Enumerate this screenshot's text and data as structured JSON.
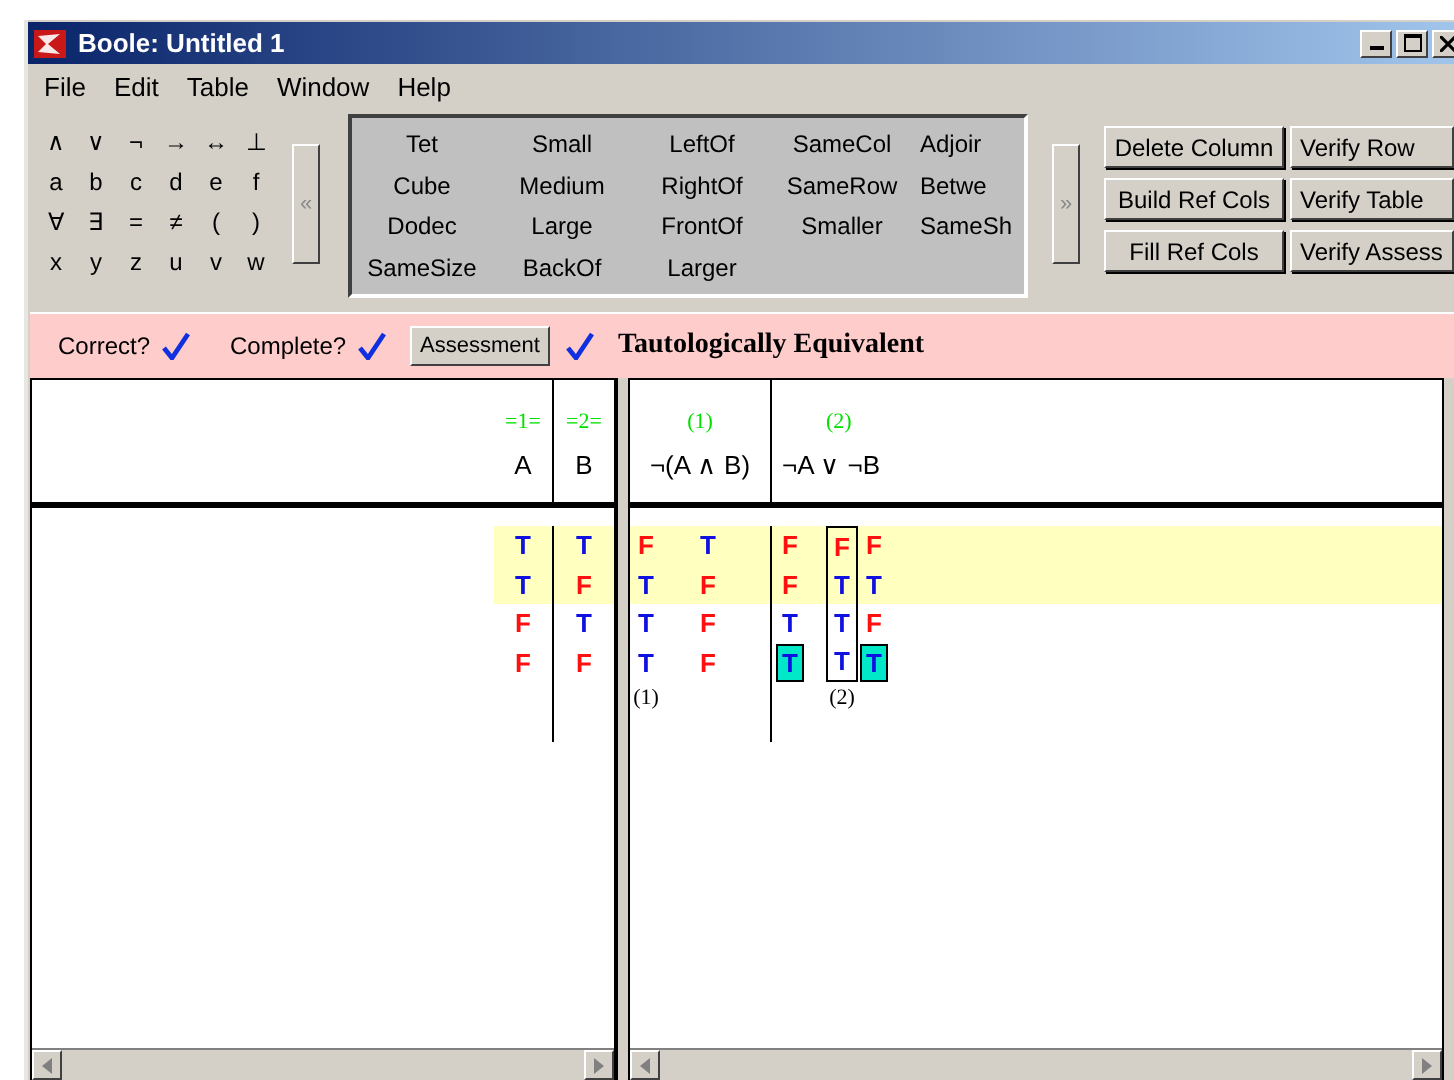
{
  "window": {
    "title": "Boole: Untitled 1"
  },
  "menu": [
    "File",
    "Edit",
    "Table",
    "Window",
    "Help"
  ],
  "symbols": [
    [
      "∧",
      "∨",
      "¬",
      "→",
      "↔",
      "⊥"
    ],
    [
      "a",
      "b",
      "c",
      "d",
      "e",
      "f"
    ],
    [
      "∀",
      "∃",
      "=",
      "≠",
      "(",
      ")"
    ],
    [
      "x",
      "y",
      "z",
      "u",
      "v",
      "w"
    ]
  ],
  "collapse_button": "«",
  "predicates": [
    [
      "Tet",
      "Small",
      "LeftOf",
      "SameCol",
      "Adjoir"
    ],
    [
      "Cube",
      "Medium",
      "RightOf",
      "SameRow",
      "Betwe"
    ],
    [
      "Dodec",
      "Large",
      "FrontOf",
      "Smaller",
      "SameSh"
    ],
    [
      "SameSize",
      "BackOf",
      "Larger"
    ]
  ],
  "expand_button": "»",
  "actions": [
    [
      "Delete Column",
      "Verify Row"
    ],
    [
      "Build Ref Cols",
      "Verify Table"
    ],
    [
      "Fill Ref Cols",
      "Verify Assess"
    ]
  ],
  "assessment": {
    "correct_label": "Correct?",
    "correct": true,
    "complete_label": "Complete?",
    "complete": true,
    "button": "Assessment",
    "assessed": true,
    "verdict": "Tautologically Equivalent"
  },
  "table": {
    "rows": [
      {
        "highlighted": true
      },
      {
        "highlighted": true
      },
      {
        "highlighted": false
      },
      {
        "highlighted": false
      }
    ],
    "ref_columns": [
      {
        "label": "=1=",
        "atom": "A",
        "cells": [
          {
            "value": "T",
            "truth": true
          },
          {
            "value": "T",
            "truth": true
          },
          {
            "value": "F",
            "truth": false
          },
          {
            "value": "F",
            "truth": false
          }
        ]
      },
      {
        "label": "=2=",
        "atom": "B",
        "cells": [
          {
            "value": "T",
            "truth": true
          },
          {
            "value": "F",
            "truth": false
          },
          {
            "value": "T",
            "truth": true
          },
          {
            "value": "F",
            "truth": false
          }
        ]
      }
    ],
    "formulas": [
      {
        "number": "(1)",
        "text": "¬(A ∧ B)",
        "columns": [
          {
            "main": true,
            "selected": false,
            "marker": "(1)",
            "cells": [
              {
                "value": "F",
                "truth": false,
                "marked": false
              },
              {
                "value": "T",
                "truth": true,
                "marked": false
              },
              {
                "value": "T",
                "truth": true,
                "marked": false
              },
              {
                "value": "T",
                "truth": true,
                "marked": false
              }
            ]
          },
          {
            "main": false,
            "selected": false,
            "cells": [
              {
                "value": "T",
                "truth": true,
                "marked": false
              },
              {
                "value": "F",
                "truth": false,
                "marked": false
              },
              {
                "value": "F",
                "truth": false,
                "marked": false
              },
              {
                "value": "F",
                "truth": false,
                "marked": false
              }
            ]
          }
        ]
      },
      {
        "number": "(2)",
        "text": "¬A ∨ ¬B",
        "columns": [
          {
            "main": false,
            "selected": false,
            "cells": [
              {
                "value": "F",
                "truth": false,
                "marked": false
              },
              {
                "value": "F",
                "truth": false,
                "marked": false
              },
              {
                "value": "T",
                "truth": true,
                "marked": false
              },
              {
                "value": "T",
                "truth": true,
                "marked": true
              }
            ]
          },
          {
            "main": true,
            "selected": true,
            "marker": "(2)",
            "cells": [
              {
                "value": "F",
                "truth": false,
                "marked": false
              },
              {
                "value": "T",
                "truth": true,
                "marked": false
              },
              {
                "value": "T",
                "truth": true,
                "marked": false
              },
              {
                "value": "T",
                "truth": true,
                "marked": false
              }
            ]
          },
          {
            "main": false,
            "selected": false,
            "cells": [
              {
                "value": "F",
                "truth": false,
                "marked": false
              },
              {
                "value": "T",
                "truth": true,
                "marked": false
              },
              {
                "value": "F",
                "truth": false,
                "marked": false
              },
              {
                "value": "T",
                "truth": true,
                "marked": true
              }
            ]
          }
        ]
      }
    ]
  }
}
